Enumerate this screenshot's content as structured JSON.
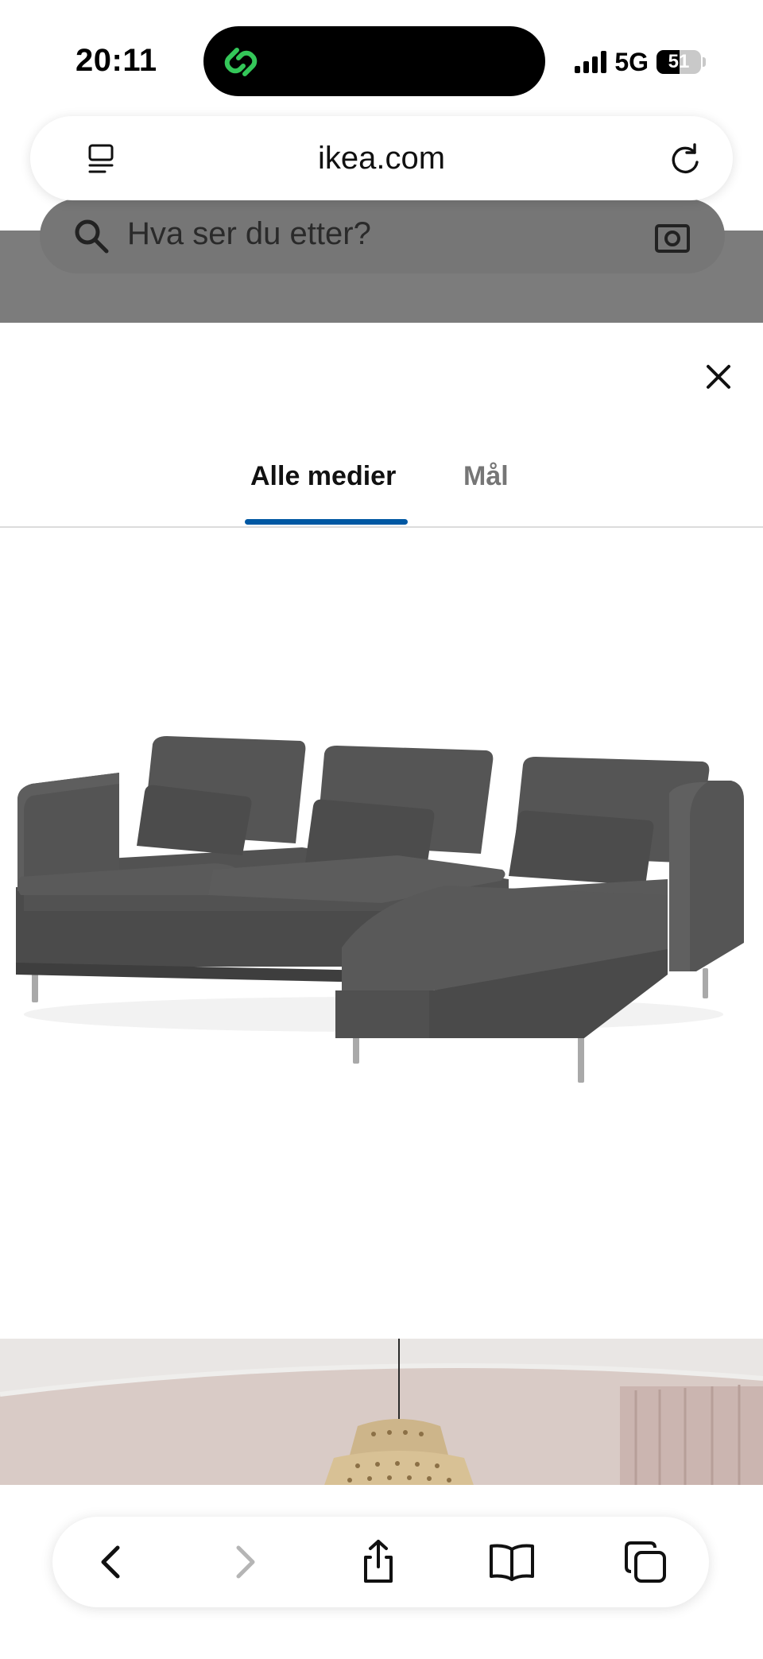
{
  "status_bar": {
    "time": "20:11",
    "network": "5G",
    "battery": "51",
    "battery_level": 0.51,
    "signal_bars": 4,
    "island_icon": "link-chain-icon",
    "island_icon_color": "#34c759"
  },
  "browser": {
    "url": "ikea.com",
    "left_icon": "reader-mode-icon",
    "right_icon": "reload-icon"
  },
  "background_page": {
    "search_placeholder": "Hva ser du etter?"
  },
  "modal": {
    "close_icon": "close-icon",
    "tabs": [
      {
        "label": "Alle medier",
        "active": true
      },
      {
        "label": "Mål",
        "active": false
      }
    ],
    "accent_color": "#0058a3",
    "media": [
      {
        "type": "product-image",
        "subject": "grey 3-seat sofa with chaise longue"
      },
      {
        "type": "room-image",
        "subject": "room with rattan pendant lamp"
      }
    ]
  },
  "toolbar": {
    "items": [
      {
        "icon": "back-chevron-icon",
        "enabled": true
      },
      {
        "icon": "forward-chevron-icon",
        "enabled": false
      },
      {
        "icon": "share-icon",
        "enabled": true
      },
      {
        "icon": "bookmarks-book-icon",
        "enabled": true
      },
      {
        "icon": "tabs-icon",
        "enabled": true
      }
    ]
  }
}
